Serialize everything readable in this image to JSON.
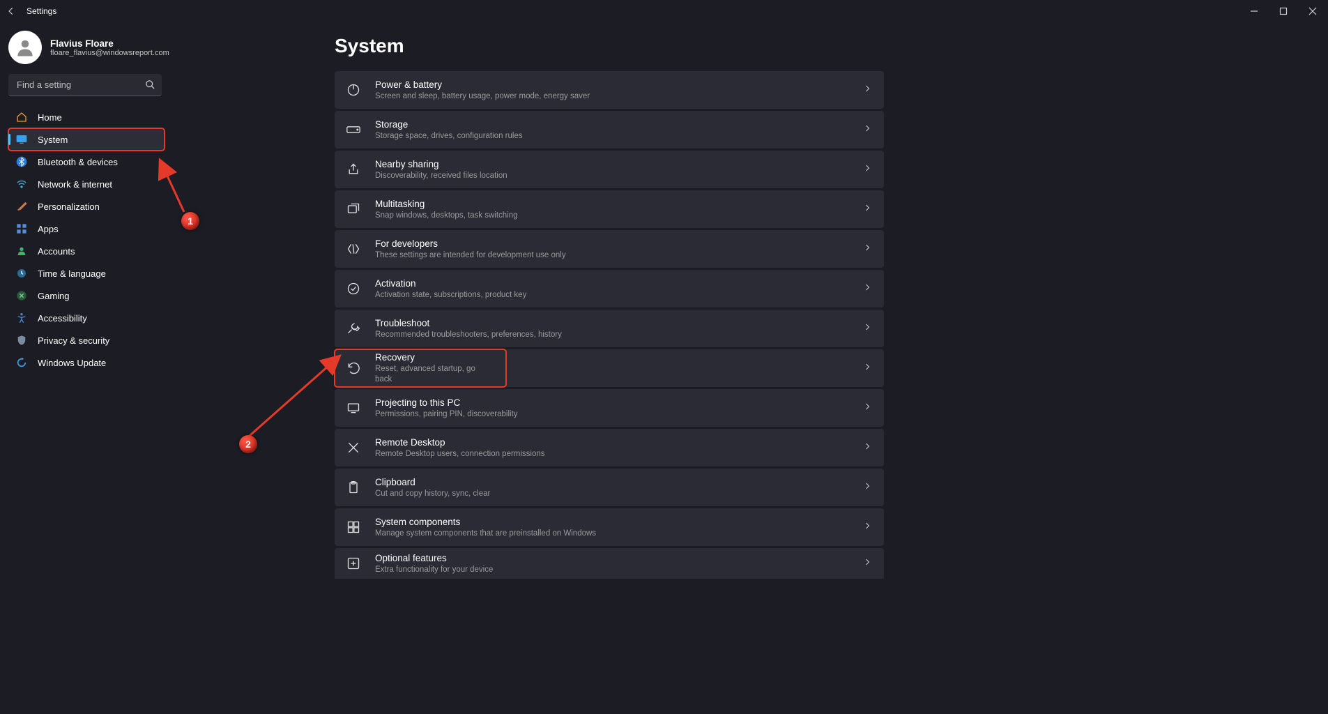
{
  "window": {
    "app_title": "Settings"
  },
  "profile": {
    "name": "Flavius Floare",
    "email": "floare_flavius@windowsreport.com"
  },
  "search": {
    "placeholder": "Find a setting"
  },
  "nav": {
    "items": [
      {
        "label": "Home",
        "icon": "home",
        "active": false
      },
      {
        "label": "System",
        "icon": "system",
        "active": true
      },
      {
        "label": "Bluetooth & devices",
        "icon": "bluetooth",
        "active": false
      },
      {
        "label": "Network & internet",
        "icon": "wifi",
        "active": false
      },
      {
        "label": "Personalization",
        "icon": "brush",
        "active": false
      },
      {
        "label": "Apps",
        "icon": "apps",
        "active": false
      },
      {
        "label": "Accounts",
        "icon": "account",
        "active": false
      },
      {
        "label": "Time & language",
        "icon": "clock",
        "active": false
      },
      {
        "label": "Gaming",
        "icon": "gaming",
        "active": false
      },
      {
        "label": "Accessibility",
        "icon": "accessibility",
        "active": false
      },
      {
        "label": "Privacy & security",
        "icon": "shield",
        "active": false
      },
      {
        "label": "Windows Update",
        "icon": "update",
        "active": false
      }
    ]
  },
  "page": {
    "heading": "System"
  },
  "settings": [
    {
      "title": "Power & battery",
      "desc": "Screen and sleep, battery usage, power mode, energy saver",
      "icon": "power"
    },
    {
      "title": "Storage",
      "desc": "Storage space, drives, configuration rules",
      "icon": "storage"
    },
    {
      "title": "Nearby sharing",
      "desc": "Discoverability, received files location",
      "icon": "share"
    },
    {
      "title": "Multitasking",
      "desc": "Snap windows, desktops, task switching",
      "icon": "multitask"
    },
    {
      "title": "For developers",
      "desc": "These settings are intended for development use only",
      "icon": "dev"
    },
    {
      "title": "Activation",
      "desc": "Activation state, subscriptions, product key",
      "icon": "activation"
    },
    {
      "title": "Troubleshoot",
      "desc": "Recommended troubleshooters, preferences, history",
      "icon": "troubleshoot"
    },
    {
      "title": "Recovery",
      "desc": "Reset, advanced startup, go back",
      "icon": "recovery"
    },
    {
      "title": "Projecting to this PC",
      "desc": "Permissions, pairing PIN, discoverability",
      "icon": "project"
    },
    {
      "title": "Remote Desktop",
      "desc": "Remote Desktop users, connection permissions",
      "icon": "remote"
    },
    {
      "title": "Clipboard",
      "desc": "Cut and copy history, sync, clear",
      "icon": "clipboard"
    },
    {
      "title": "System components",
      "desc": "Manage system components that are preinstalled on Windows",
      "icon": "components"
    },
    {
      "title": "Optional features",
      "desc": "Extra functionality for your device",
      "icon": "optional"
    }
  ],
  "annotations": {
    "badge1": "1",
    "badge2": "2"
  }
}
